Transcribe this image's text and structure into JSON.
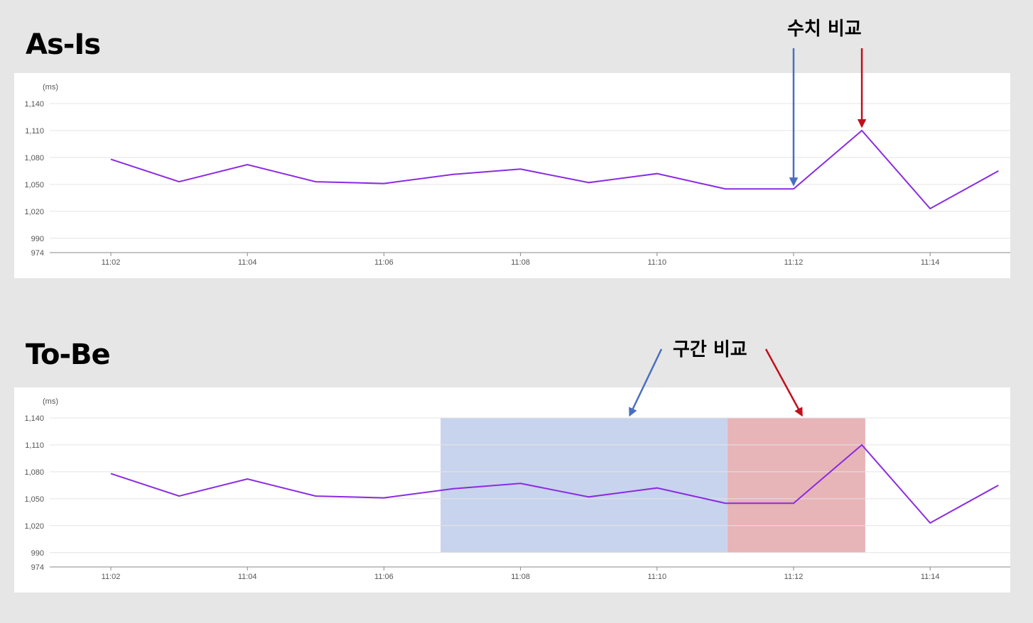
{
  "sections": {
    "asis_title": "As-Is",
    "tobe_title": "To-Be"
  },
  "annotations": {
    "asis_label": "수치 비교",
    "tobe_label": "구간 비교",
    "colors": {
      "blue": "#4a6fc0",
      "red": "#c0101c"
    }
  },
  "colors": {
    "line": "#8a2be2",
    "grid": "#e4e4e4",
    "axis": "#888888",
    "highlight_blue": "#c8d3ed",
    "highlight_red": "#e7b4b8"
  },
  "chart_data": [
    {
      "name": "As-Is",
      "type": "line",
      "unit": "(ms)",
      "x": [
        "11:02",
        "11:03",
        "11:04",
        "11:05",
        "11:06",
        "11:07",
        "11:08",
        "11:09",
        "11:10",
        "11:11",
        "11:12",
        "11:13",
        "11:14",
        "11:15"
      ],
      "values": [
        1078,
        1053,
        1072,
        1053,
        1051,
        1061,
        1067,
        1052,
        1062,
        1045,
        1045,
        1110,
        1023,
        1065
      ],
      "x_ticks": [
        "11:02",
        "11:04",
        "11:06",
        "11:08",
        "11:10",
        "11:12",
        "11:14"
      ],
      "y_ticks": [
        "1,140",
        "1,110",
        "1,080",
        "1,050",
        "1,020",
        "990",
        "974"
      ],
      "ylim": [
        974,
        1140
      ],
      "grid": true,
      "point_markers": [
        {
          "x": "11:12",
          "color": "blue"
        },
        {
          "x": "11:13",
          "color": "red"
        }
      ]
    },
    {
      "name": "To-Be",
      "type": "line",
      "unit": "(ms)",
      "x": [
        "11:02",
        "11:03",
        "11:04",
        "11:05",
        "11:06",
        "11:07",
        "11:08",
        "11:09",
        "11:10",
        "11:11",
        "11:12",
        "11:13",
        "11:14",
        "11:15"
      ],
      "values": [
        1078,
        1053,
        1072,
        1053,
        1051,
        1061,
        1067,
        1052,
        1062,
        1045,
        1045,
        1110,
        1023,
        1065
      ],
      "x_ticks": [
        "11:02",
        "11:04",
        "11:06",
        "11:08",
        "11:10",
        "11:12",
        "11:14"
      ],
      "y_ticks": [
        "1,140",
        "1,110",
        "1,080",
        "1,050",
        "1,020",
        "990",
        "974"
      ],
      "ylim": [
        974,
        1140
      ],
      "grid": true,
      "ranges": [
        {
          "from": 6.83,
          "to": 11.03,
          "color": "blue"
        },
        {
          "from": 11.03,
          "to": 13.05,
          "color": "red"
        }
      ]
    }
  ]
}
